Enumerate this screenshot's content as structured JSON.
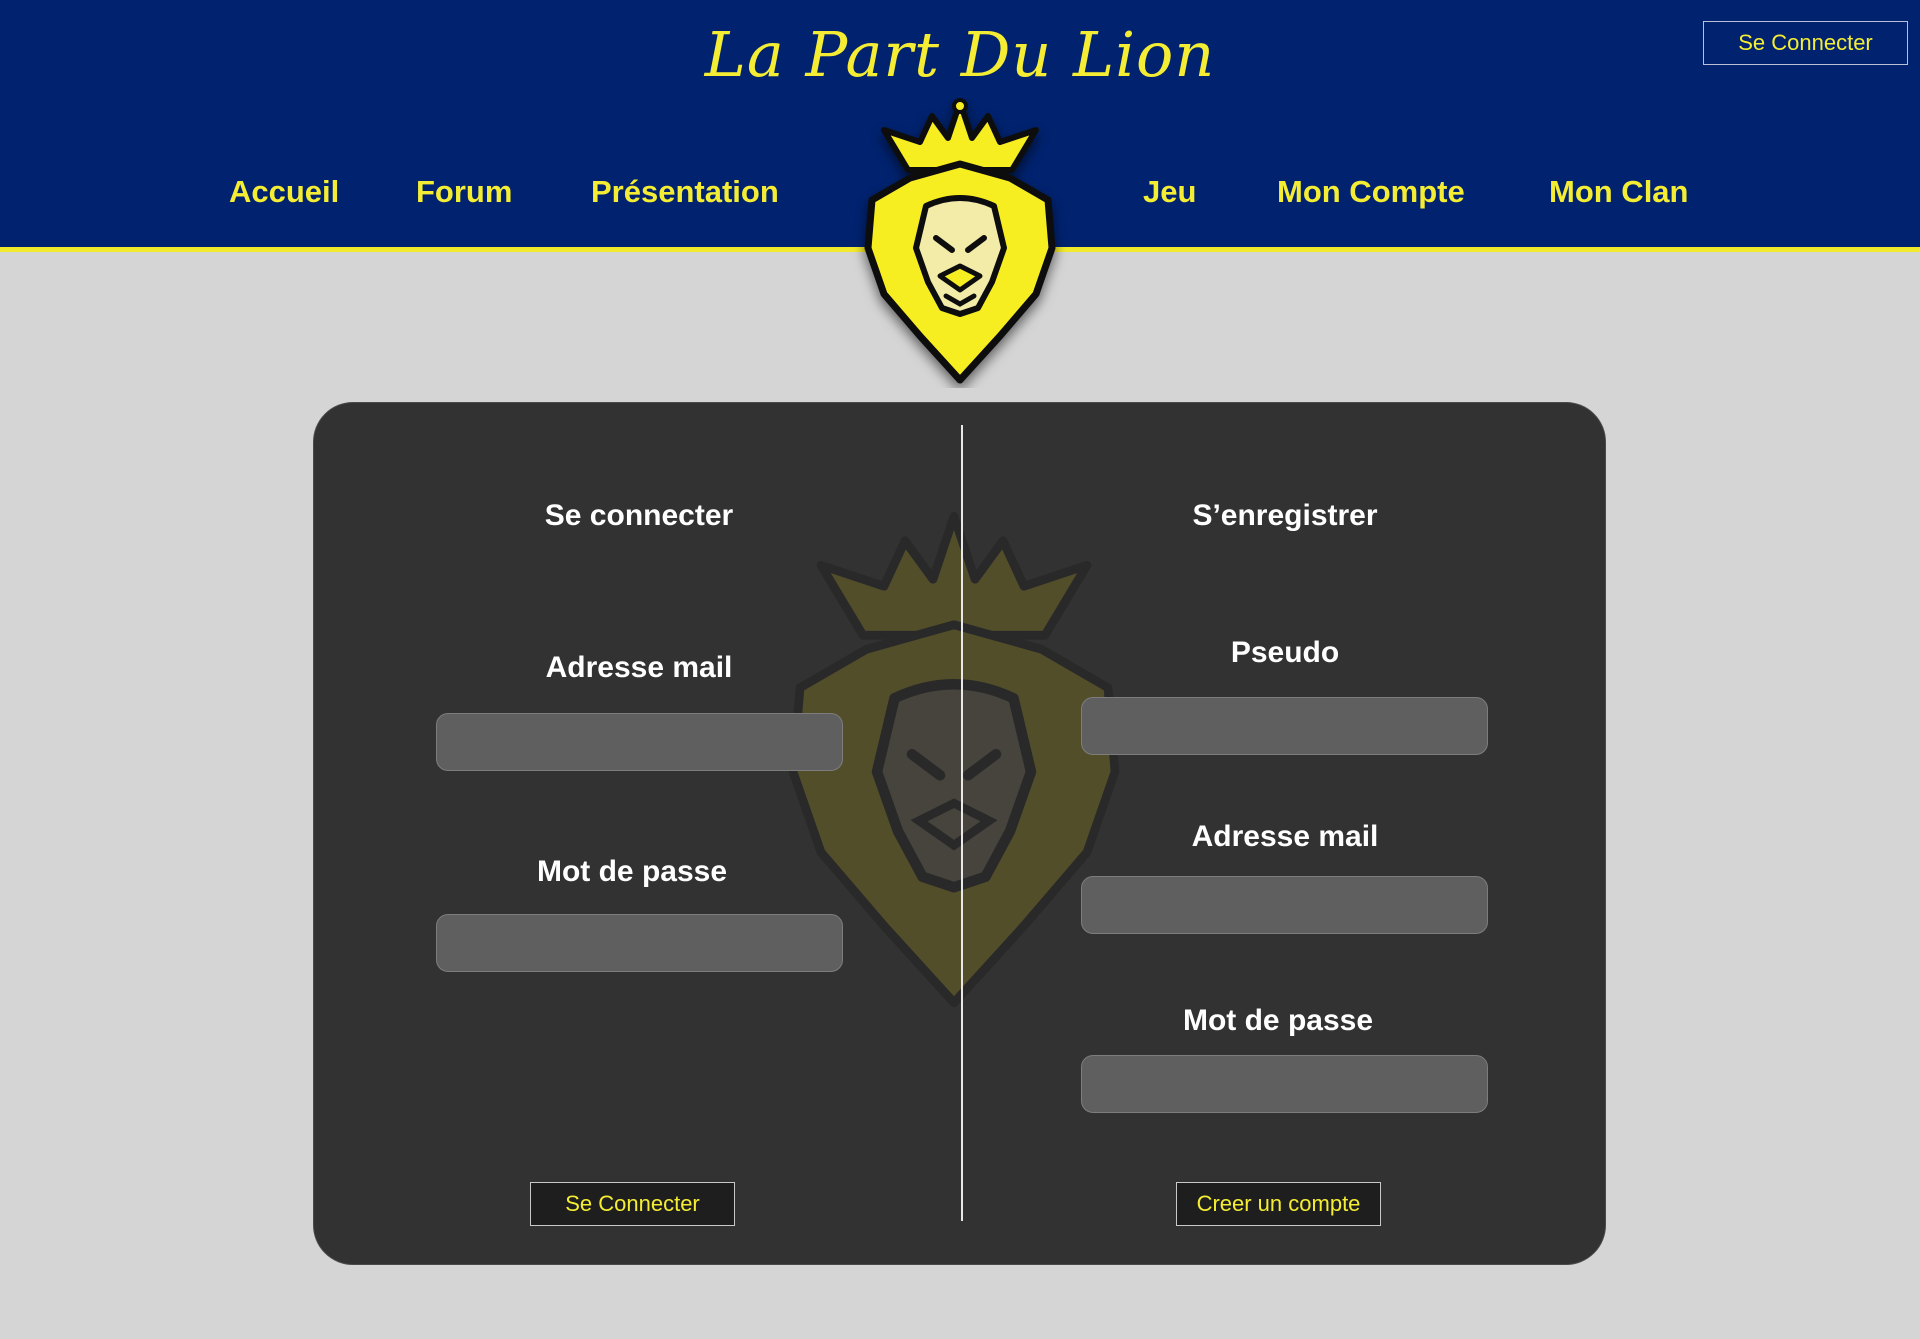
{
  "header": {
    "brand": "La Part Du Lion",
    "login_button": "Se Connecter",
    "nav": [
      {
        "label": "Accueil"
      },
      {
        "label": "Forum"
      },
      {
        "label": "Présentation"
      },
      {
        "label": "Jeu"
      },
      {
        "label": "Mon Compte"
      },
      {
        "label": "Mon Clan"
      }
    ],
    "logo_icon": "lion-crown-logo-icon"
  },
  "login": {
    "title": "Se connecter",
    "email_label": "Adresse mail",
    "email_value": "",
    "password_label": "Mot de passe",
    "password_value": "",
    "submit": "Se Connecter"
  },
  "register": {
    "title": "S’enregistrer",
    "pseudo_label": "Pseudo",
    "pseudo_value": "",
    "email_label": "Adresse mail",
    "email_value": "",
    "password_label": "Mot de passe",
    "password_value": "",
    "submit": "Creer un compte"
  },
  "colors": {
    "header_bg": "#00226f",
    "accent_yellow": "#f4ed33",
    "page_bg": "#d5d5d5",
    "panel_bg": "#323232",
    "field_bg": "#5f5f5f"
  }
}
